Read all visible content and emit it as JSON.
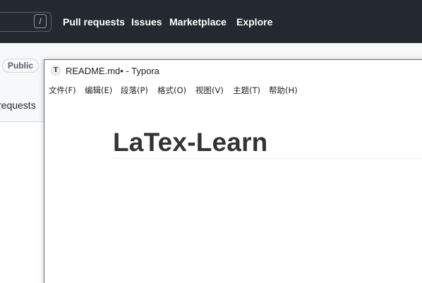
{
  "github": {
    "search_shortcut": "/",
    "nav": [
      "Pull requests",
      "Issues",
      "Marketplace",
      "Explore"
    ],
    "visibility_badge": "Public",
    "tab_partial": "requests"
  },
  "typora": {
    "window_title": "README.md• - Typora",
    "app_icon_letter": "T",
    "menu": [
      "文件(F)",
      "编辑(E)",
      "段落(P)",
      "格式(O)",
      "视图(V)",
      "主题(T)",
      "帮助(H)"
    ],
    "document": {
      "heading": "LaTex-Learn"
    }
  },
  "colors": {
    "github_header": "#24292f",
    "github_subheader": "#f6f8fa",
    "heading_text": "#333333"
  }
}
